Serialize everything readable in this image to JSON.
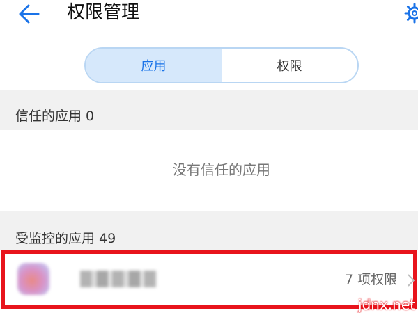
{
  "header": {
    "title": "权限管理"
  },
  "segment": {
    "tabs": [
      {
        "label": "应用",
        "active": true
      },
      {
        "label": "权限",
        "active": false
      }
    ]
  },
  "trusted": {
    "label": "信任的应用 0",
    "empty_text": "没有信任的应用"
  },
  "monitored": {
    "label": "受监控的应用 49",
    "apps": [
      {
        "count_text": "7 项权限"
      }
    ]
  },
  "watermark": "jdnx.net",
  "colors": {
    "accent": "#1a73e8",
    "active_tab_bg": "#d6e8fb",
    "highlight_border": "#e8141c",
    "section_bg": "#f1f1f1"
  },
  "icons": {
    "back": "arrow-left-icon",
    "settings": "gear-icon",
    "chevron": "chevron-right-icon"
  }
}
